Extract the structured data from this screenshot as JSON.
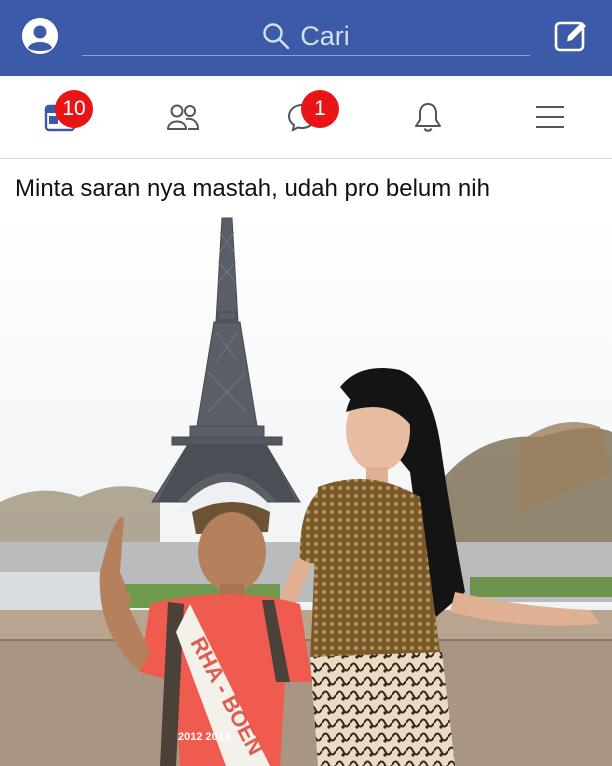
{
  "header": {
    "search_placeholder": "Cari",
    "profile_icon": "profile-icon",
    "compose_icon": "compose-icon",
    "brand_color": "#3b5ba8"
  },
  "nav": {
    "items": [
      {
        "name": "events-icon",
        "badge": "10"
      },
      {
        "name": "friends-icon",
        "badge": ""
      },
      {
        "name": "messenger-icon",
        "badge": "1"
      },
      {
        "name": "notifications-icon",
        "badge": ""
      },
      {
        "name": "menu-icon",
        "badge": ""
      }
    ],
    "badge_color": "#e81416"
  },
  "post": {
    "text": "Minta saran nya mastah, udah pro belum nih",
    "photo_sash_text": "RHA - BOEN",
    "photo_sash_year": "2012 2013"
  }
}
